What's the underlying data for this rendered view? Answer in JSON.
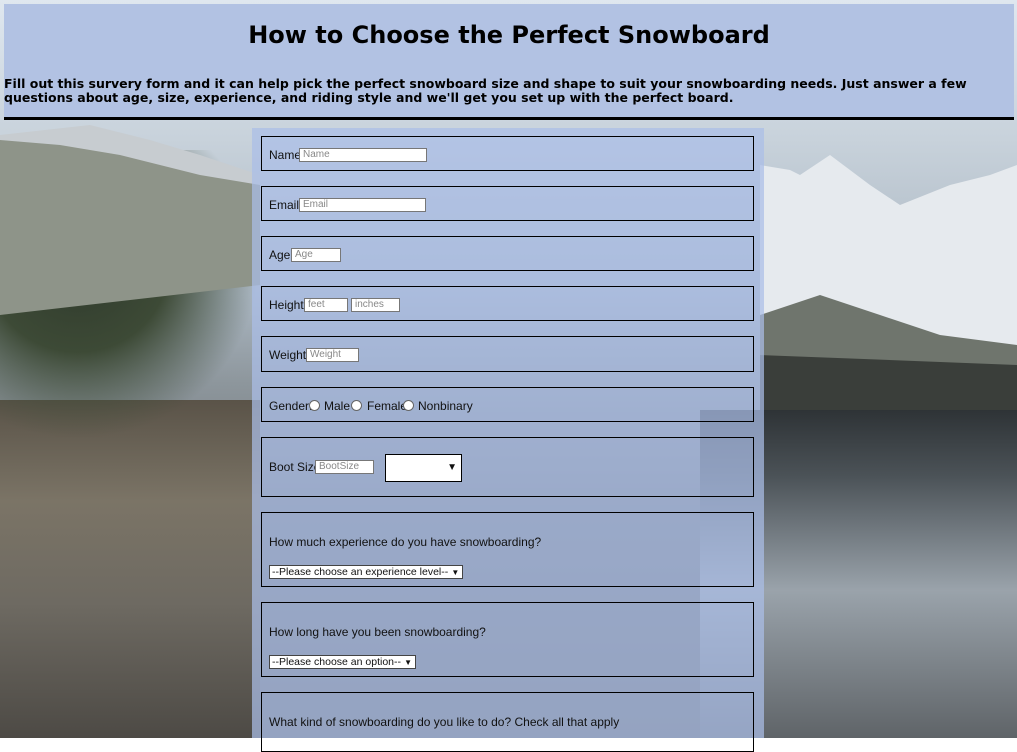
{
  "header": {
    "title": "How to Choose the Perfect Snowboard",
    "description": "Fill out this survery form and it can help pick the perfect snowboard size and shape to suit your snowboarding needs. Just answer a few questions about age, size, experience, and riding style and we'll get you set up with the perfect board."
  },
  "form": {
    "name": {
      "label": "Name:",
      "placeholder": "Name"
    },
    "email": {
      "label": "Email:",
      "placeholder": "Email"
    },
    "age": {
      "label": "Age:",
      "placeholder": "Age"
    },
    "height": {
      "label": "Height:",
      "feet_placeholder": "feet",
      "inches_placeholder": "inches"
    },
    "weight": {
      "label": "Weight:",
      "placeholder": "Weight"
    },
    "gender": {
      "label": "Gender:",
      "options": [
        "Male",
        "Female",
        "Nonbinary"
      ]
    },
    "boot_size": {
      "label": "Boot Size:",
      "placeholder": "BootSize",
      "unit_value": ""
    },
    "experience": {
      "question": "How much experience do you have snowboarding?",
      "selected": "--Please choose an experience level--"
    },
    "duration": {
      "question": "How long have you been snowboarding?",
      "selected": "--Please choose an option--"
    },
    "style": {
      "question": "What kind of snowboarding do you like to do? Check all that apply"
    }
  },
  "colors": {
    "header_bg": "#b2c2e3",
    "form_bg": "#aabee8"
  }
}
